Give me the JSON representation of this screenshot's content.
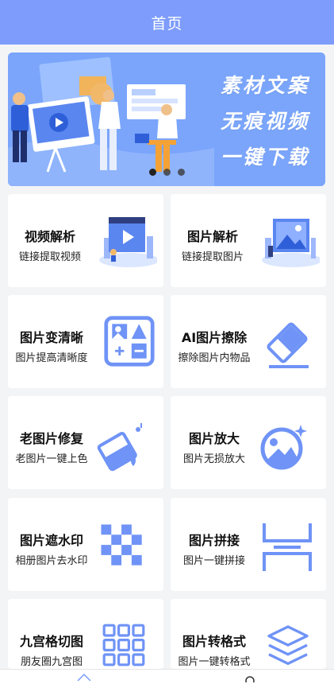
{
  "header": {
    "title": "首页"
  },
  "banner": {
    "slogan_lines": [
      "素材文案",
      "无痕视频",
      "一键下载"
    ],
    "active_dot": 0,
    "dot_count": 3
  },
  "features": [
    {
      "title": "视频解析",
      "subtitle": "链接提取视频",
      "icon": "video-parse-illustration"
    },
    {
      "title": "图片解析",
      "subtitle": "链接提取图片",
      "icon": "image-parse-illustration"
    },
    {
      "title": "图片变清晰",
      "subtitle": "图片提高清晰度",
      "icon": "image-sharpen-icon"
    },
    {
      "title": "AI图片擦除",
      "subtitle": "擦除图片内物品",
      "icon": "eraser-icon"
    },
    {
      "title": "老图片修复",
      "subtitle": "老图片一键上色",
      "icon": "paint-bucket-icon"
    },
    {
      "title": "图片放大",
      "subtitle": "图片无损放大",
      "icon": "image-enlarge-icon"
    },
    {
      "title": "图片遮水印",
      "subtitle": "相册图片去水印",
      "icon": "mosaic-icon"
    },
    {
      "title": "图片拼接",
      "subtitle": "图片一键拼接",
      "icon": "image-join-icon"
    },
    {
      "title": "九宫格切图",
      "subtitle": "朋友圈九宫图",
      "icon": "grid-nine-icon"
    },
    {
      "title": "图片转格式",
      "subtitle": "图片一键转格式",
      "icon": "layers-icon"
    }
  ],
  "colors": {
    "accent": "#7d9cfb",
    "icon_blue": "#6f93f6",
    "background": "#f3f4f6"
  },
  "tabbar": {
    "icons": [
      "home-icon",
      "search-icon"
    ]
  }
}
